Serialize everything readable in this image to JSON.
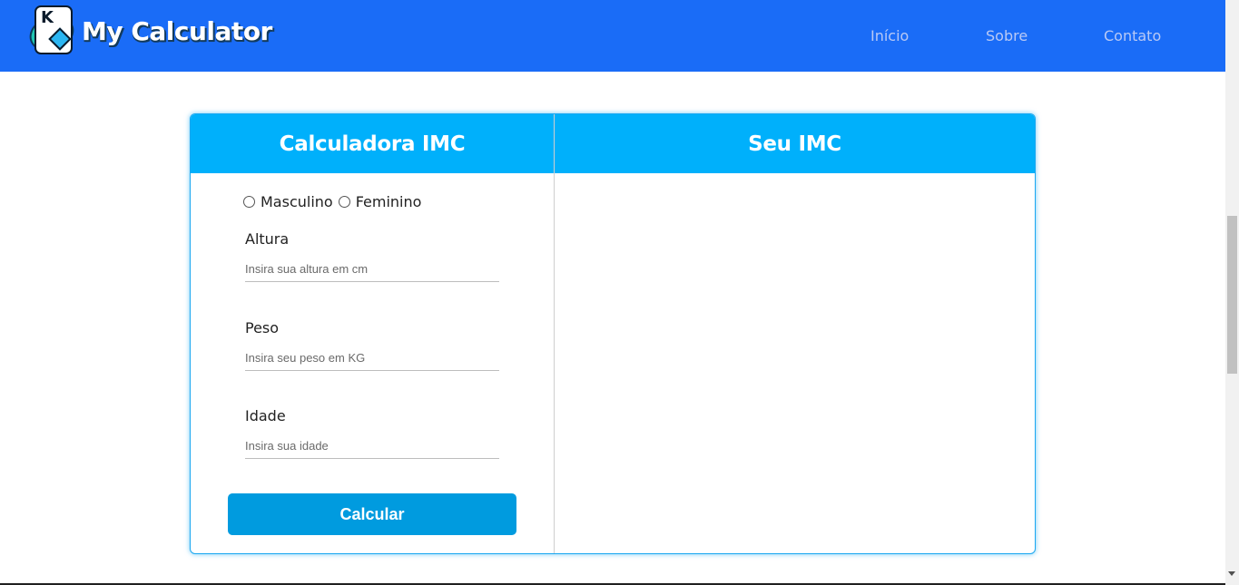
{
  "navbar": {
    "brand_name": "My Calculator",
    "logo_icon": "playing-card-logo-icon",
    "links": [
      {
        "label": "Início"
      },
      {
        "label": "Sobre"
      },
      {
        "label": "Contato"
      }
    ],
    "colors": {
      "background": "#1a6cf7",
      "link": "#b9c9f5"
    }
  },
  "calculator": {
    "title": "Calculadora IMC",
    "result_title": "Seu IMC",
    "gender": {
      "options": [
        {
          "label": "Masculino",
          "checked": false
        },
        {
          "label": "Feminino",
          "checked": false
        }
      ]
    },
    "fields": [
      {
        "label": "Altura",
        "value": "",
        "placeholder": "Insira sua altura em cm"
      },
      {
        "label": "Peso",
        "value": "",
        "placeholder": "Insira seu peso em KG"
      },
      {
        "label": "Idade",
        "value": "",
        "placeholder": "Insira sua idade"
      }
    ],
    "button_label": "Calcular",
    "colors": {
      "header": "#00b0fb",
      "button": "#009bdf",
      "border": "#1aa7f0"
    }
  }
}
